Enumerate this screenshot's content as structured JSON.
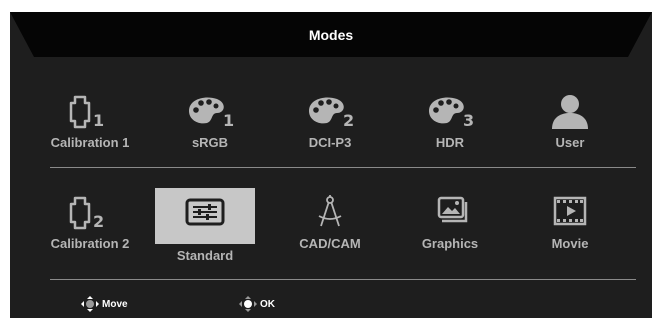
{
  "header": {
    "title": "Modes"
  },
  "modes_row1": [
    {
      "label": "Calibration 1",
      "icon": "calibration-icon",
      "badge": "1"
    },
    {
      "label": "sRGB",
      "icon": "palette-icon",
      "badge": "1"
    },
    {
      "label": "DCI-P3",
      "icon": "palette-icon",
      "badge": "2"
    },
    {
      "label": "HDR",
      "icon": "palette-icon",
      "badge": "3"
    },
    {
      "label": "User",
      "icon": "user-icon"
    }
  ],
  "modes_row2": [
    {
      "label": "Calibration 2",
      "icon": "calibration-icon",
      "badge": "2"
    },
    {
      "label": "Standard",
      "icon": "sliders-icon",
      "selected": true
    },
    {
      "label": "CAD/CAM",
      "icon": "compass-icon"
    },
    {
      "label": "Graphics",
      "icon": "image-icon"
    },
    {
      "label": "Movie",
      "icon": "film-icon"
    }
  ],
  "footer": {
    "move_label": "Move",
    "ok_label": "OK"
  },
  "colors": {
    "panel": "#1e1e1e",
    "title_bar": "#050505",
    "selected_bg": "#c7c7c7",
    "text": "#b5b5b5"
  }
}
